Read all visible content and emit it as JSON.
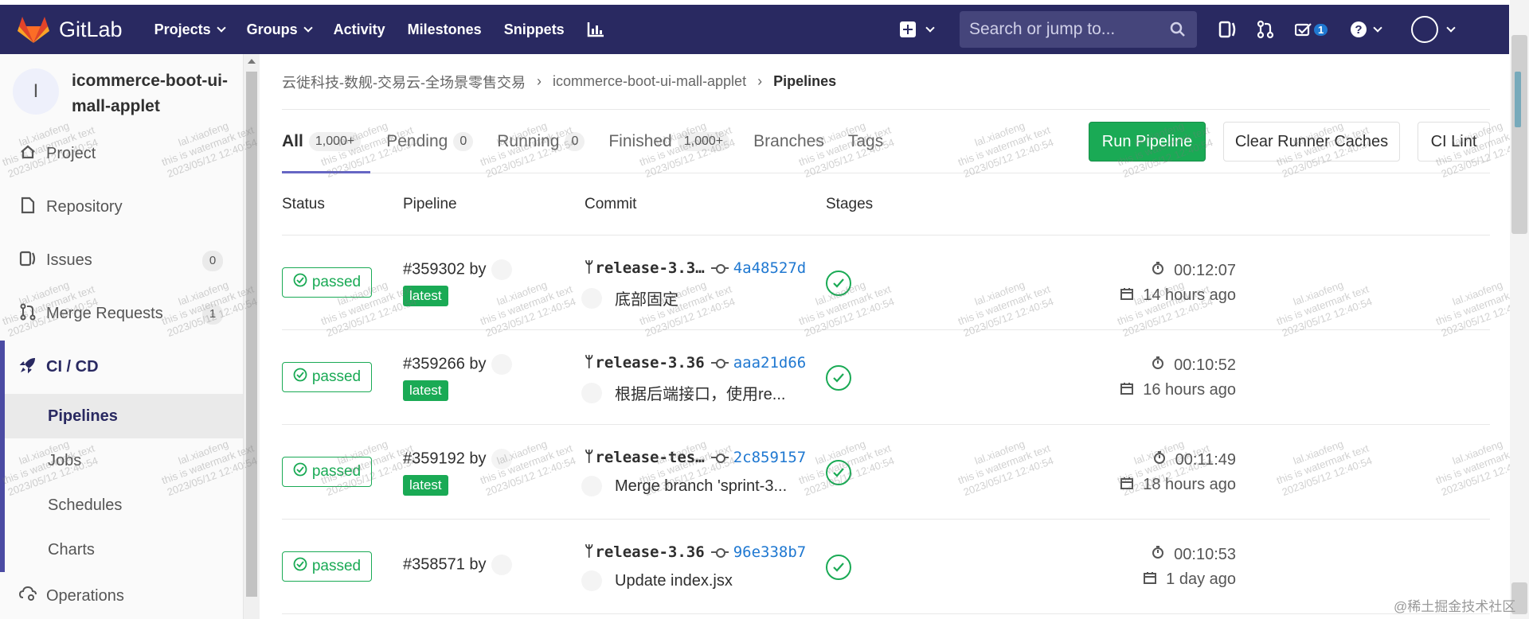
{
  "navbar": {
    "brand": "GitLab",
    "links": [
      {
        "label": "Projects",
        "dropdown": true
      },
      {
        "label": "Groups",
        "dropdown": true
      },
      {
        "label": "Activity",
        "dropdown": false
      },
      {
        "label": "Milestones",
        "dropdown": false
      },
      {
        "label": "Snippets",
        "dropdown": false
      }
    ],
    "search_placeholder": "Search or jump to...",
    "todo_count": "1",
    "bg_color": "#292961"
  },
  "sidebar": {
    "avatar_letter": "I",
    "project_name": "icommerce-boot-ui-mall-applet",
    "items": [
      {
        "label": "Project",
        "icon": "home-icon"
      },
      {
        "label": "Repository",
        "icon": "document-icon"
      },
      {
        "label": "Issues",
        "icon": "issues-icon",
        "count": "0"
      },
      {
        "label": "Merge Requests",
        "icon": "merge-request-icon",
        "count": "1"
      },
      {
        "label": "CI / CD",
        "icon": "rocket-icon"
      }
    ],
    "sub_items": [
      "Pipelines",
      "Jobs",
      "Schedules",
      "Charts"
    ],
    "next_item": "Operations"
  },
  "breadcrumb": {
    "group": "云徙科技-数舰-交易云-全场景零售交易",
    "project": "icommerce-boot-ui-mall-applet",
    "current": "Pipelines"
  },
  "tabs": [
    {
      "label": "All",
      "count": "1,000+"
    },
    {
      "label": "Pending",
      "count": "0"
    },
    {
      "label": "Running",
      "count": "0"
    },
    {
      "label": "Finished",
      "count": "1,000+"
    },
    {
      "label": "Branches"
    },
    {
      "label": "Tags"
    }
  ],
  "buttons": {
    "run_pipeline": "Run Pipeline",
    "clear_caches": "Clear Runner Caches",
    "ci_lint": "CI Lint"
  },
  "table": {
    "headers": {
      "status": "Status",
      "pipeline": "Pipeline",
      "commit": "Commit",
      "stages": "Stages"
    },
    "rows": [
      {
        "status": "passed",
        "id": "#359302 by",
        "latest": "latest",
        "branch": "release-3.3…",
        "sha": "4a48527d",
        "message": "底部固定",
        "duration": "00:12:07",
        "ago": "14 hours ago"
      },
      {
        "status": "passed",
        "id": "#359266 by",
        "latest": "latest",
        "branch": "release-3.36",
        "sha": "aaa21d66",
        "message": "根据后端接口，使用re...",
        "duration": "00:10:52",
        "ago": "16 hours ago"
      },
      {
        "status": "passed",
        "id": "#359192 by",
        "latest": "latest",
        "branch": "release-tes…",
        "sha": "2c859157",
        "message": "Merge branch 'sprint-3...",
        "duration": "00:11:49",
        "ago": "18 hours ago"
      },
      {
        "status": "passed",
        "id": "#358571 by",
        "latest": "",
        "branch": "release-3.36",
        "sha": "96e338b7",
        "message": "Update index.jsx",
        "duration": "00:10:53",
        "ago": "1 day ago"
      }
    ]
  },
  "watermark": {
    "line1": "lal.xiaofeng",
    "line2": "this is watermark text",
    "line3": "2023/05/12 12:40:54",
    "corner": "@稀土掘金技术社区"
  },
  "colors": {
    "success": "#1aaa55",
    "link": "#1f78d1",
    "active_nav": "#6666c4"
  }
}
